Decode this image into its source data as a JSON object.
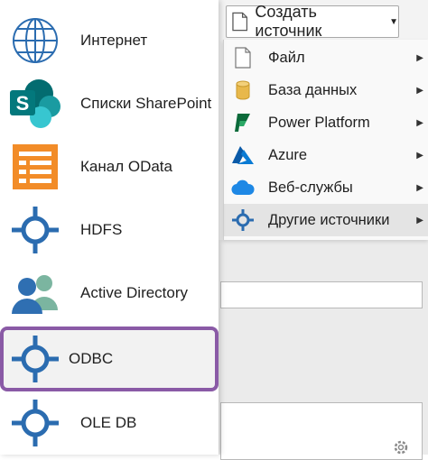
{
  "toolbar": {
    "create_source_label": "Создать источник"
  },
  "submenu": {
    "items": [
      {
        "label": "Файл",
        "icon": "file-icon",
        "has_submenu": true
      },
      {
        "label": "База данных",
        "icon": "database-icon",
        "has_submenu": true
      },
      {
        "label": "Power Platform",
        "icon": "power-platform-icon",
        "has_submenu": true
      },
      {
        "label": "Azure",
        "icon": "azure-icon",
        "has_submenu": true
      },
      {
        "label": "Веб-службы",
        "icon": "cloud-icon",
        "has_submenu": true
      },
      {
        "label": "Другие источники",
        "icon": "connector-icon",
        "has_submenu": true,
        "selected": true
      }
    ]
  },
  "flyout": {
    "items": [
      {
        "label": "Интернет",
        "icon": "globe-icon"
      },
      {
        "label": "Списки SharePoint",
        "icon": "sharepoint-icon"
      },
      {
        "label": "Канал OData",
        "icon": "odata-icon"
      },
      {
        "label": "HDFS",
        "icon": "connector-icon"
      },
      {
        "label": "Active Directory",
        "icon": "active-directory-icon"
      },
      {
        "label": "ODBC",
        "icon": "connector-icon",
        "highlighted": true
      },
      {
        "label": "OLE DB",
        "icon": "connector-icon"
      }
    ]
  },
  "colors": {
    "connector_blue": "#2b6cb0",
    "highlight_border": "#8a5aa6",
    "sharepoint_teal": "#036c70",
    "odata_orange": "#f28c28",
    "azure_blue": "#0078d4",
    "power_platform_green": "#0b6a3a",
    "database_gold": "#e8b84b"
  }
}
